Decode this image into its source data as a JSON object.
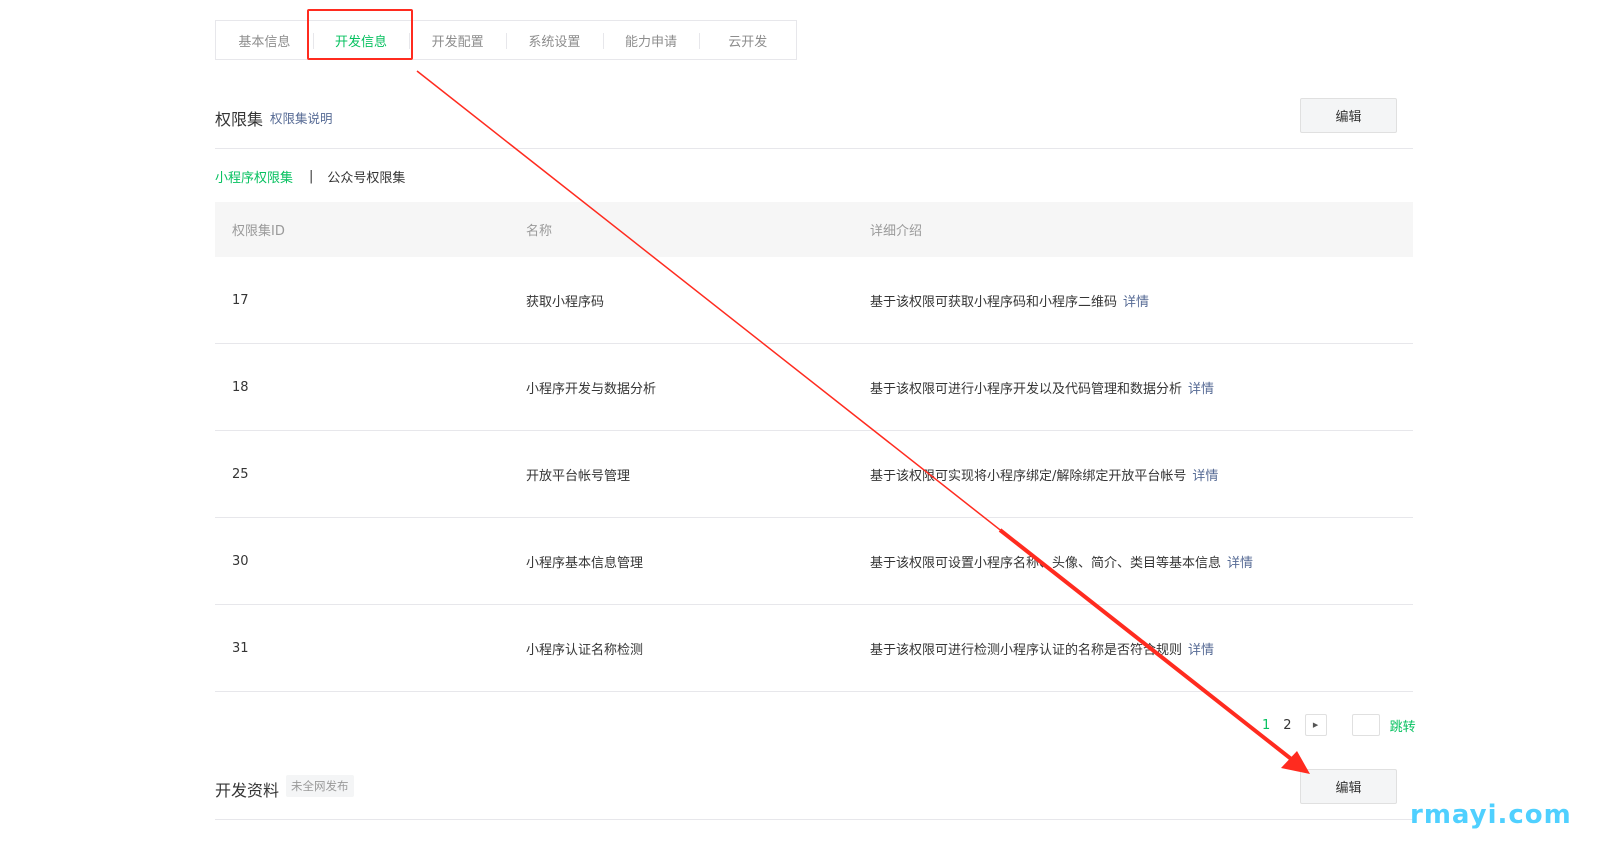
{
  "tabs": [
    "基本信息",
    "开发信息",
    "开发配置",
    "系统设置",
    "能力申请",
    "云开发"
  ],
  "active_tab_index": 1,
  "permissions": {
    "title": "权限集",
    "help_link": "权限集说明",
    "edit_label": "编辑",
    "subtabs": {
      "active": "小程序权限集",
      "separator": "|",
      "other": "公众号权限集"
    },
    "columns": [
      "权限集ID",
      "名称",
      "详细介绍"
    ],
    "detail_link_label": "详情",
    "rows": [
      {
        "id": "17",
        "name": "获取小程序码",
        "desc": "基于该权限可获取小程序码和小程序二维码"
      },
      {
        "id": "18",
        "name": "小程序开发与数据分析",
        "desc": "基于该权限可进行小程序开发以及代码管理和数据分析"
      },
      {
        "id": "25",
        "name": "开放平台帐号管理",
        "desc": "基于该权限可实现将小程序绑定/解除绑定开放平台帐号"
      },
      {
        "id": "30",
        "name": "小程序基本信息管理",
        "desc": "基于该权限可设置小程序名称、头像、简介、类目等基本信息"
      },
      {
        "id": "31",
        "name": "小程序认证名称检测",
        "desc": "基于该权限可进行检测小程序认证的名称是否符合规则"
      }
    ]
  },
  "pagination": {
    "pages": [
      "1",
      "2"
    ],
    "current": "1",
    "next_icon": "▶",
    "jump_label": "跳转"
  },
  "dev_docs": {
    "title": "开发资料",
    "badge": "未全网发布",
    "edit_label": "编辑"
  },
  "watermark": "rmayi.com",
  "colors": {
    "accent": "#07c160",
    "link": "#576b95",
    "annotation": "#ff2b1f"
  }
}
